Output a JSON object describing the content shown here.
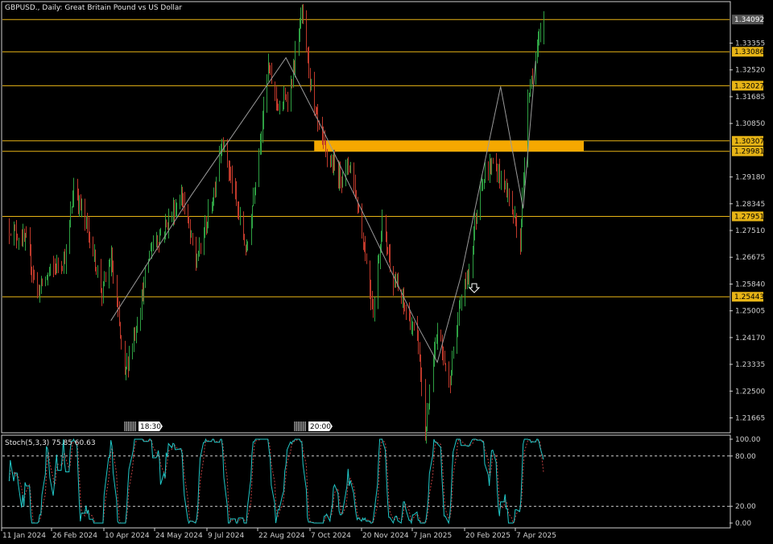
{
  "header": {
    "symbol": "GBPUSD.",
    "period": "Daily",
    "description": "Great Britain Pound vs US Dollar"
  },
  "indicator": {
    "label": "Stoch(5,3,3) 75.85 60.63",
    "levels": [
      "100.00",
      "80.00",
      "20.00",
      "0.00"
    ]
  },
  "colors": {
    "background": "#000000",
    "panel_background": "#111111",
    "axis": "#cfcfcf",
    "bull": "#2ea043",
    "bear": "#c0392b",
    "level_line": "#e7b416",
    "zone_fill": "#f5a800",
    "trendline": "#9a9a9a",
    "main_line": "#20c8c8",
    "signal_line": "#c04040",
    "price_tag": "#555555"
  },
  "session_markers": [
    {
      "icon": "session-marker-icon",
      "label": "18:30"
    },
    {
      "icon": "session-marker-icon",
      "label": "20:00"
    }
  ],
  "arrow_icon": "down-arrow-icon",
  "chart_data": [
    {
      "type": "candlestick",
      "title": "GBPUSD., Daily:  Great Britain Pound vs US Dollar",
      "ylim": [
        1.2125,
        1.3455
      ],
      "price_axis_ticks": [
        "1.33355",
        "1.32520",
        "1.31685",
        "1.30850",
        "1.29180",
        "1.28345",
        "1.27510",
        "1.26675",
        "1.25840",
        "1.25005",
        "1.24170",
        "1.23335",
        "1.22500",
        "1.21665"
      ],
      "date_axis_labels": [
        "11 Jan 2024",
        "26 Feb 2024",
        "10 Apr 2024",
        "24 May 2024",
        "9 Jul 2024",
        "22 Aug 2024",
        "7 Oct 2024",
        "20 Nov 2024",
        "7 Jan 2025",
        "20 Feb 2025",
        "7 Apr 2025"
      ],
      "current_price": "1.34092",
      "horizontal_levels": [
        {
          "label": "1.33086",
          "value": 1.33086
        },
        {
          "label": "1.32027",
          "value": 1.32027
        },
        {
          "label": "1.30307",
          "value": 1.30307
        },
        {
          "label": "1.29981",
          "value": 1.29981
        },
        {
          "label": "1.27951",
          "value": 1.27951
        },
        {
          "label": "1.25443",
          "value": 1.25443
        }
      ],
      "zone": {
        "low": 1.29981,
        "high": 1.30307,
        "start": "7 Oct 2024",
        "end": "28 Apr 2025"
      },
      "price_path": [
        {
          "date": "11 Jan 2024",
          "close": 1.276
        },
        {
          "date": "26 Jan 2024",
          "close": 1.271
        },
        {
          "date": "5 Feb 2024",
          "close": 1.256
        },
        {
          "date": "15 Feb 2024",
          "close": 1.262
        },
        {
          "date": "1 Mar 2024",
          "close": 1.267
        },
        {
          "date": "8 Mar 2024",
          "close": 1.289
        },
        {
          "date": "20 Mar 2024",
          "close": 1.276
        },
        {
          "date": "2 Apr 2024",
          "close": 1.256
        },
        {
          "date": "10 Apr 2024",
          "close": 1.266
        },
        {
          "date": "22 Apr 2024",
          "close": 1.23
        },
        {
          "date": "5 May 2024",
          "close": 1.25
        },
        {
          "date": "15 May 2024",
          "close": 1.27
        },
        {
          "date": "24 May 2024",
          "close": 1.274
        },
        {
          "date": "12 Jun 2024",
          "close": 1.286
        },
        {
          "date": "24 Jun 2024",
          "close": 1.265
        },
        {
          "date": "9 Jul 2024",
          "close": 1.285
        },
        {
          "date": "17 Jul 2024",
          "close": 1.304
        },
        {
          "date": "29 Jul 2024",
          "close": 1.285
        },
        {
          "date": "8 Aug 2024",
          "close": 1.268
        },
        {
          "date": "22 Aug 2024",
          "close": 1.31
        },
        {
          "date": "27 Aug 2024",
          "close": 1.326
        },
        {
          "date": "6 Sep 2024",
          "close": 1.312
        },
        {
          "date": "16 Sep 2024",
          "close": 1.32
        },
        {
          "date": "26 Sep 2024",
          "close": 1.343
        },
        {
          "date": "7 Oct 2024",
          "close": 1.312
        },
        {
          "date": "18 Oct 2024",
          "close": 1.298
        },
        {
          "date": "30 Oct 2024",
          "close": 1.292
        },
        {
          "date": "8 Nov 2024",
          "close": 1.296
        },
        {
          "date": "20 Nov 2024",
          "close": 1.27
        },
        {
          "date": "28 Nov 2024",
          "close": 1.25
        },
        {
          "date": "6 Dec 2024",
          "close": 1.278
        },
        {
          "date": "16 Dec 2024",
          "close": 1.26
        },
        {
          "date": "27 Dec 2024",
          "close": 1.25
        },
        {
          "date": "7 Jan 2025",
          "close": 1.24
        },
        {
          "date": "13 Jan 2025",
          "close": 1.211
        },
        {
          "date": "24 Jan 2025",
          "close": 1.245
        },
        {
          "date": "3 Feb 2025",
          "close": 1.227
        },
        {
          "date": "14 Feb 2025",
          "close": 1.255
        },
        {
          "date": "20 Feb 2025",
          "close": 1.261
        },
        {
          "date": "3 Mar 2025",
          "close": 1.29
        },
        {
          "date": "14 Mar 2025",
          "close": 1.296
        },
        {
          "date": "25 Mar 2025",
          "close": 1.289
        },
        {
          "date": "4 Apr 2025",
          "close": 1.276
        },
        {
          "date": "7 Apr 2025",
          "close": 1.271
        },
        {
          "date": "14 Apr 2025",
          "close": 1.318
        },
        {
          "date": "21 Apr 2025",
          "close": 1.329
        },
        {
          "date": "28 Apr 2025",
          "close": 1.3409
        }
      ]
    },
    {
      "type": "line",
      "title": "Stoch(5,3,3) 75.85 60.63",
      "ylim": [
        0,
        100
      ],
      "levels": [
        20,
        80
      ],
      "last_values": {
        "main": 75.85,
        "signal": 60.63
      }
    }
  ]
}
